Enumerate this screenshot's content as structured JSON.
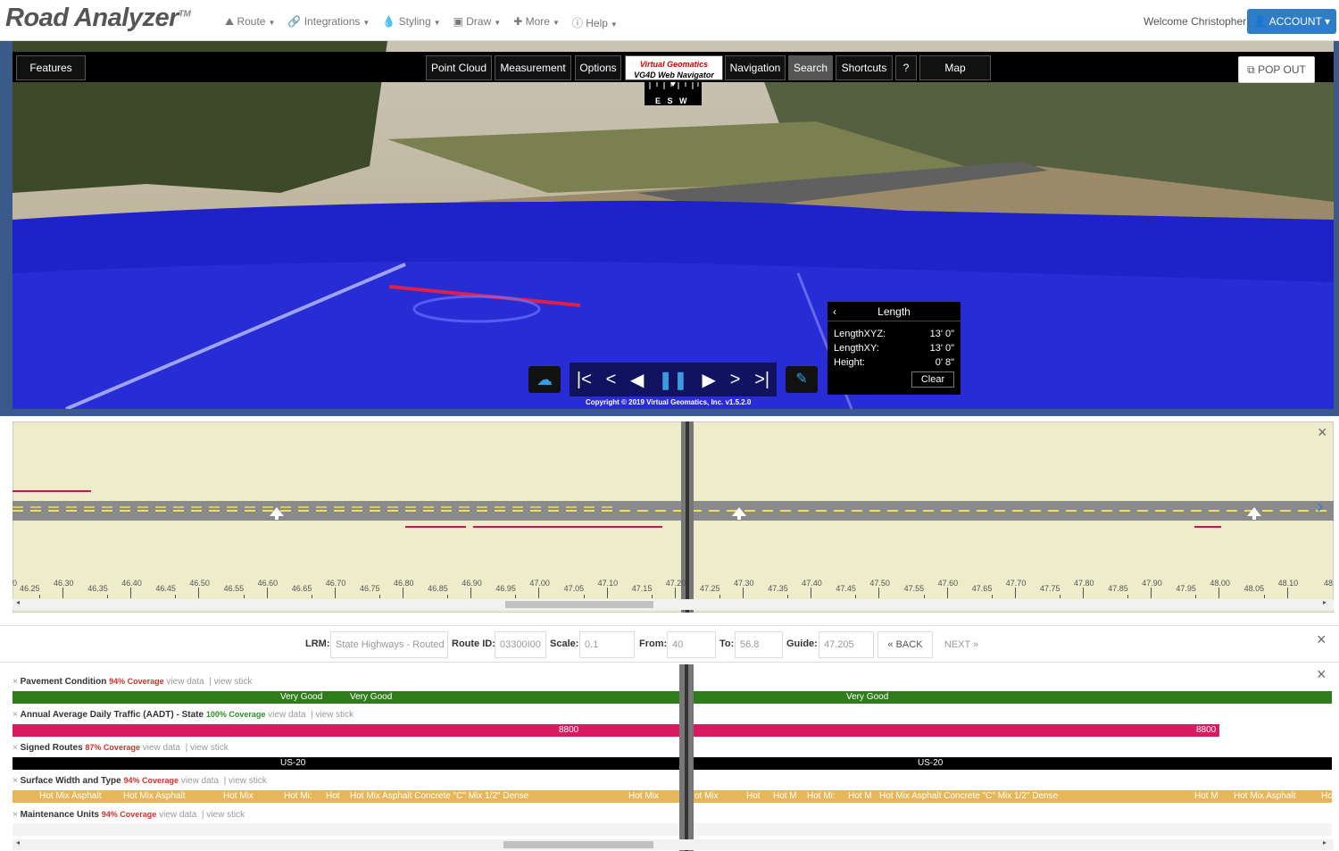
{
  "app": {
    "logo": "Road Analyzer",
    "tm": "TM"
  },
  "nav": {
    "route": "Route",
    "integrations": "Integrations",
    "styling": "Styling",
    "draw": "Draw",
    "more": "More",
    "help": "Help",
    "welcome": "Welcome Christopher!",
    "account": "ACCOUNT"
  },
  "viewer": {
    "features": "Features",
    "point_cloud": "Point Cloud",
    "measurement": "Measurement",
    "options": "Options",
    "vg_line1": "Virtual Geomatics",
    "vg_line2": "VG4D Web Navigator",
    "navigation": "Navigation",
    "search": "Search",
    "shortcuts": "Shortcuts",
    "help": "?",
    "map": "Map",
    "pop_out": "POP OUT",
    "compass": "E   S   W",
    "copyright": "Copyright © 2019 Virtual Geomatics, Inc. v1.5.2.0"
  },
  "length_panel": {
    "title": "Length",
    "rows": [
      {
        "label": "LengthXYZ:",
        "value": "13' 0\""
      },
      {
        "label": "LengthXY:",
        "value": "13' 0\""
      },
      {
        "label": "Height:",
        "value": "0' 8\""
      }
    ],
    "clear": "Clear"
  },
  "stick": {
    "ticks_major": [
      "46.30",
      "46.40",
      "46.50",
      "46.60",
      "46.70",
      "46.80",
      "46.90",
      "47.00",
      "47.10",
      "47.20",
      "47.30",
      "47.40",
      "47.50",
      "47.60",
      "47.70",
      "47.80",
      "47.90",
      "48.00",
      "48.10"
    ],
    "ticks_minor": [
      "46.25",
      "46.35",
      "46.45",
      "46.55",
      "46.65",
      "46.75",
      "46.85",
      "46.95",
      "47.05",
      "47.15",
      "47.25",
      "47.35",
      "47.45",
      "47.55",
      "47.65",
      "47.75",
      "47.85",
      "47.95",
      "48.05"
    ],
    "tick_left": "0",
    "tick_right": "48"
  },
  "lrm": {
    "lrm_label": "LRM:",
    "lrm_value": "State Highways - Routed",
    "route_label": "Route ID:",
    "route_value": "03300I00",
    "scale_label": "Scale:",
    "scale_value": "0.1",
    "from_label": "From:",
    "from_value": "40",
    "to_label": "To:",
    "to_value": "56.8",
    "guide_label": "Guide:",
    "guide_value": "47.205",
    "back": "« BACK",
    "next": "NEXT »"
  },
  "layers": [
    {
      "name": "Pavement Condition",
      "coverage": "94% Coverage",
      "view_data": "view data",
      "view_stick": "| view stick"
    },
    {
      "name": "Annual Average Daily Traffic (AADT) - State",
      "coverage": "100% Coverage",
      "view_data": "view data",
      "view_stick": "| view stick"
    },
    {
      "name": "Signed Routes",
      "coverage": "87% Coverage",
      "view_data": "view data",
      "view_stick": "| view stick"
    },
    {
      "name": "Surface Width and Type",
      "coverage": "94% Coverage",
      "view_data": "view data",
      "view_stick": "| view stick"
    },
    {
      "name": "Maintenance Units",
      "coverage": "94% Coverage",
      "view_data": "view data",
      "view_stick": "| view stick"
    }
  ],
  "bars": {
    "pavement": [
      "Very Good",
      "Very Good",
      "Very Good"
    ],
    "aadt": [
      "8800",
      "8800"
    ],
    "signed": [
      "US-20",
      "US-20"
    ],
    "surface": [
      "Hot Mix Asphalt",
      "Hot Mix Asphalt",
      "Hot Mix",
      "Hot Mi:",
      "Hot",
      "Hot Mix Asphalt Concrete \"C\" Mix 1/2\" Dense",
      "Hot Mix",
      "ot Mix",
      "Hot",
      "Hot M",
      "Hot Mi:",
      "Hot M",
      "Hot Mix Asphalt Concrete \"C\" Mix 1/2\" Dense",
      "Hot M",
      "Hot Mix Asphalt",
      "Hc"
    ]
  },
  "colors": {
    "account": "#2f7cc7",
    "pavement": "#2e7d1a",
    "aadt": "#d81b60",
    "signed": "#000000",
    "surface": "#e5b75a",
    "coverage_red": "#d0312d",
    "coverage_green": "#2e8b2e"
  }
}
